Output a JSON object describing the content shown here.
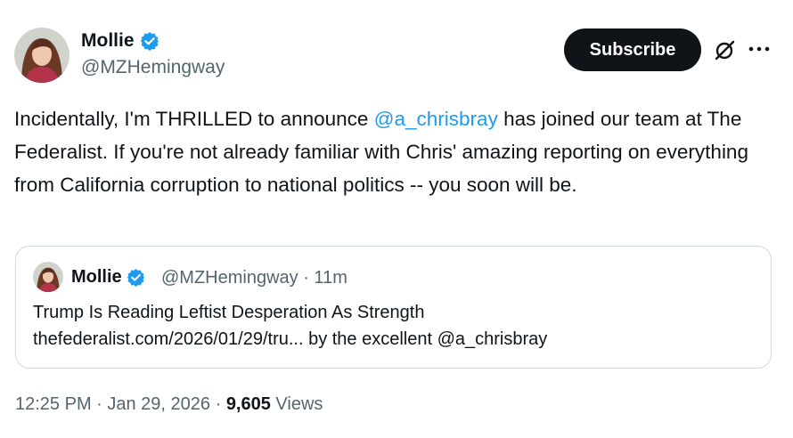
{
  "author": {
    "name": "Mollie",
    "handle": "@MZHemingway",
    "verified_color": "#1d9bf0"
  },
  "actions": {
    "subscribe_label": "Subscribe",
    "grok_icon": "grok-slash-icon",
    "more_icon": "more-horizontal-icon"
  },
  "tweet": {
    "text_part1": "Incidentally, I'm THRILLED to announce ",
    "mention": "@a_chrisbray",
    "text_part2": " has joined our team at The Federalist. If you're not already familiar with Chris' amazing reporting on everything from California corruption to national politics -- you soon will be."
  },
  "quote": {
    "name": "Mollie",
    "handle_time": "@MZHemingway · 11m",
    "title": "Trump Is Reading Leftist Desperation As Strength",
    "link_line": "thefederalist.com/2026/01/29/tru... by the excellent @a_chrisbray"
  },
  "footer": {
    "timestamp": "12:25 PM · Jan 29, 2026 · ",
    "views_count": "9,605",
    "views_label": " Views"
  },
  "colors": {
    "text": "#0f1419",
    "secondary": "#536471",
    "link": "#1d9bf0",
    "border": "#cfd9de"
  }
}
